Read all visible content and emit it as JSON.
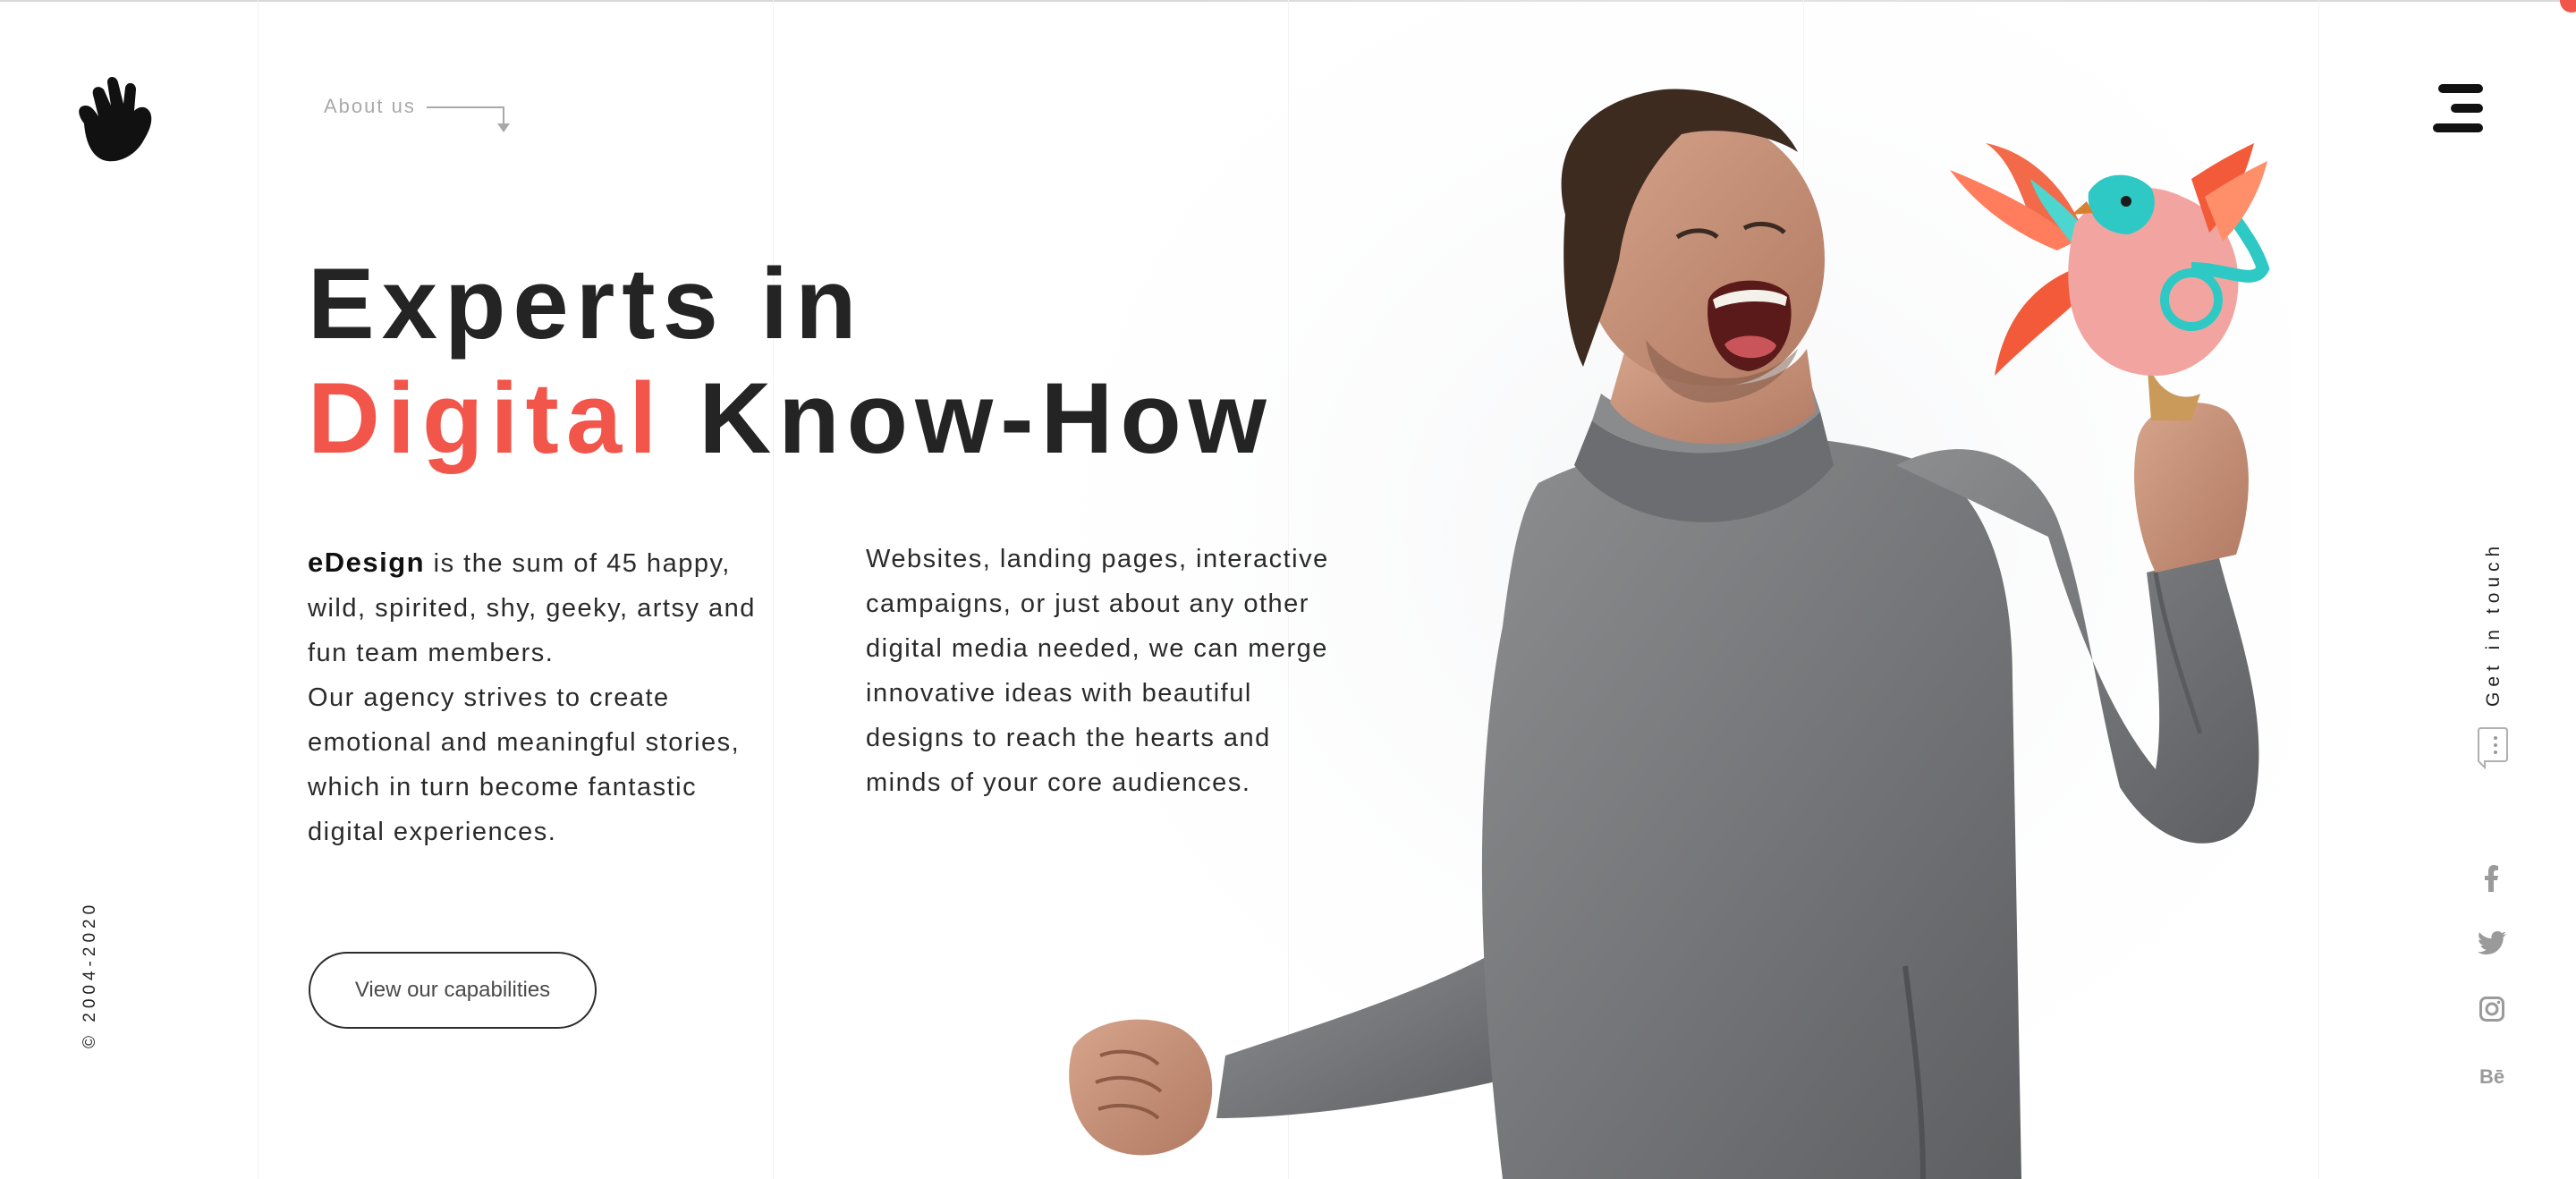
{
  "brand": {
    "logo_icon": "hand-wave-icon"
  },
  "nav": {
    "about_label": "About us",
    "menu_icon": "menu-icon"
  },
  "hero": {
    "headline_line1": "Experts in",
    "headline_accent": "Digital",
    "headline_rest": "Know-How",
    "accent_color": "#f2554a"
  },
  "intro": {
    "left_brand": "eDesign",
    "left_text_1": " is the sum of 45 happy, wild, spirited, shy, geeky, artsy and fun team members.",
    "left_text_2": "Our agency strives to create emotional and meaningful stories, which in turn become fantastic digital experiences.",
    "right_text": "Websites, landing pages, interactive campaigns, or just about any other digital media needed, we can merge innovative ideas with beautiful designs to reach the hearts and minds of your core audiences."
  },
  "cta": {
    "label": "View our capabilities"
  },
  "footer": {
    "copyright": "© 2004-2020"
  },
  "contact": {
    "label": "Get in touch",
    "icon": "chat-bubble-icon"
  },
  "social": {
    "facebook": "facebook-icon",
    "twitter": "twitter-icon",
    "instagram": "instagram-icon",
    "behance_label": "Bē"
  }
}
